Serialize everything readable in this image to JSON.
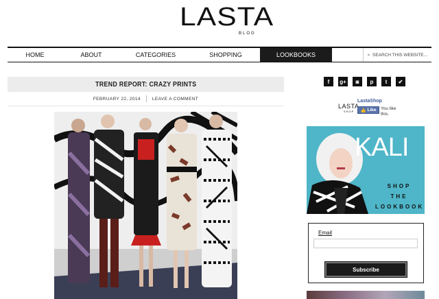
{
  "logo": {
    "text": "LASTA",
    "sub": "BLOG"
  },
  "nav": {
    "items": [
      {
        "label": "HOME",
        "active": false
      },
      {
        "label": "ABOUT",
        "active": false
      },
      {
        "label": "CATEGORIES",
        "active": false
      },
      {
        "label": "SHOPPING",
        "active": false
      },
      {
        "label": "LOOKBOOKS",
        "active": true
      }
    ],
    "search_placeholder": "SEARCH THIS WEBSITE..."
  },
  "post": {
    "title": "TREND REPORT: CRAZY PRINTS",
    "date": "FEBRUARY 22, 2014",
    "comment_link": "LEAVE A COMMENT"
  },
  "sidebar": {
    "social": [
      {
        "name": "facebook-icon",
        "glyph": "f"
      },
      {
        "name": "google-plus-icon",
        "glyph": "g+"
      },
      {
        "name": "instagram-icon",
        "glyph": "◙"
      },
      {
        "name": "pinterest-icon",
        "glyph": "p"
      },
      {
        "name": "tumblr-icon",
        "glyph": "t"
      },
      {
        "name": "twitter-icon",
        "glyph": "✔"
      }
    ],
    "fb": {
      "logo": "LASTA",
      "logo_sub": "SHOP",
      "page_name": "LastaShop",
      "like_label": "Like",
      "likes_text": "You like this."
    },
    "ad": {
      "brand": "KALI",
      "line1": "SHOP",
      "line2": "THE",
      "line3": "LOOKBOOK"
    },
    "signup": {
      "label": "Email",
      "button": "Subscribe"
    }
  },
  "colors": {
    "nav_active_bg": "#1b1b1b",
    "title_bar_bg": "#ececec",
    "ad_bg": "#4fb5c8",
    "fb_blue": "#3b5998"
  }
}
